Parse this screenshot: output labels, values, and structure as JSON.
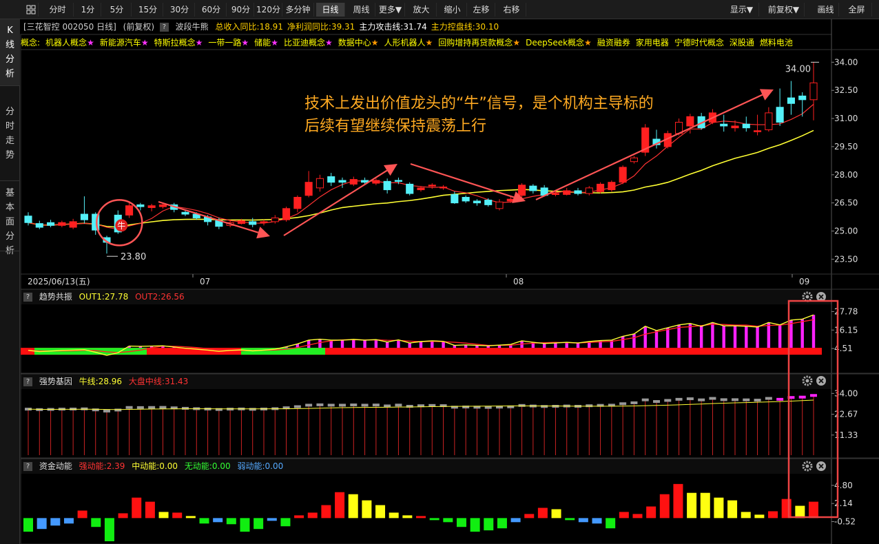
{
  "toolbar": {
    "items": [
      {
        "label": "分时"
      },
      {
        "label": "1分"
      },
      {
        "label": "5分"
      },
      {
        "label": "15分"
      },
      {
        "label": "30分"
      },
      {
        "label": "60分"
      },
      {
        "label": "90分"
      },
      {
        "label": "120分"
      },
      {
        "label": "多分钟"
      },
      {
        "label": "日线",
        "active": true
      },
      {
        "label": "周线"
      },
      {
        "label": "更多▼"
      },
      {
        "label": "放大"
      },
      {
        "label": "缩小"
      },
      {
        "label": "左移"
      },
      {
        "label": "右移"
      }
    ],
    "right": [
      {
        "label": "显示▼"
      },
      {
        "label": "前复权▼"
      },
      {
        "label": "画线"
      },
      {
        "label": "全屏"
      }
    ]
  },
  "sidebar": [
    {
      "label": "K线分析",
      "active": true
    },
    {
      "label": "分时走势"
    },
    {
      "label": "基本面分析"
    }
  ],
  "header": {
    "stock": "[三花智控 002050 日线]",
    "adjust": "(前复权)",
    "indicator": "波段牛熊",
    "fields": [
      {
        "text": "总收入同比:18.91",
        "color": "#ffd000"
      },
      {
        "text": "净利润同比:39.31",
        "color": "#ffd000"
      },
      {
        "text": "主力攻击线:31.74",
        "color": "#ffffff"
      },
      {
        "text": "主力控盘线:30.10",
        "color": "#ffd000"
      }
    ]
  },
  "concepts": {
    "prefix": "概念:",
    "items": [
      {
        "name": "机器人概念",
        "star": "★",
        "star_color": "magenta"
      },
      {
        "name": "新能源汽车",
        "star": "★",
        "star_color": "magenta"
      },
      {
        "name": "特斯拉概念",
        "star": "★",
        "star_color": "magenta"
      },
      {
        "name": "一带一路",
        "star": "★",
        "star_color": "magenta"
      },
      {
        "name": "储能",
        "star": "★",
        "star_color": "magenta"
      },
      {
        "name": "比亚迪概念",
        "star": "★",
        "star_color": "magenta"
      },
      {
        "name": "数据中心",
        "star": "★",
        "star_color": "orange"
      },
      {
        "name": "人形机器人",
        "star": "★",
        "star_color": "orange"
      },
      {
        "name": "回购增持再贷款概念",
        "star": "★",
        "star_color": "orange"
      },
      {
        "name": "DeepSeek概念",
        "star": "★",
        "star_color": "orange"
      },
      {
        "name": "融资融券",
        "star": "",
        "star_color": ""
      },
      {
        "name": "家用电器",
        "star": "",
        "star_color": ""
      },
      {
        "name": "宁德时代概念",
        "star": "",
        "star_color": ""
      },
      {
        "name": "深股通",
        "star": "",
        "star_color": ""
      },
      {
        "name": "燃料电池",
        "star": "",
        "star_color": ""
      }
    ]
  },
  "main_chart": {
    "y_ticks": [
      "34.00",
      "32.50",
      "31.00",
      "29.50",
      "28.00",
      "26.50",
      "25.00",
      "23.50"
    ],
    "y_range": [
      23.0,
      34.6
    ],
    "date_label": "2025/06/13(五)",
    "month_labels": [
      "07",
      "08",
      "09"
    ],
    "high_label": "34.00",
    "low_label": "23.80",
    "signal_label": "牛",
    "annotation_line1": "技术上发出价值龙头的“牛”信号，是个机构主导标的",
    "annotation_line2": "后续有望继续保持震荡上行",
    "colors": {
      "up": "#ff2020",
      "down": "#54f0f8",
      "ma_fast": "#ff3333",
      "ma_slow": "#ffff33",
      "arrow": "#ff5555"
    }
  },
  "candles": [
    [
      25.8,
      25.45,
      26.0,
      25.3
    ],
    [
      25.4,
      25.2,
      25.55,
      25.1
    ],
    [
      25.45,
      25.3,
      25.6,
      25.2
    ],
    [
      25.3,
      25.45,
      25.55,
      25.2
    ],
    [
      25.2,
      25.5,
      25.65,
      25.1
    ],
    [
      25.9,
      25.6,
      26.85,
      25.4
    ],
    [
      25.9,
      25.05,
      26.0,
      24.8
    ],
    [
      24.65,
      24.4,
      24.75,
      23.8
    ],
    [
      25.85,
      24.95,
      26.1,
      24.85
    ],
    [
      25.85,
      26.35,
      26.6,
      25.7
    ],
    [
      26.4,
      26.3,
      26.5,
      26.1
    ],
    [
      26.25,
      26.35,
      26.45,
      26.05
    ],
    [
      26.3,
      26.4,
      26.5,
      26.2
    ],
    [
      26.4,
      26.15,
      26.5,
      26.0
    ],
    [
      26.0,
      25.9,
      26.1,
      25.8
    ],
    [
      25.9,
      25.7,
      26.0,
      25.6
    ],
    [
      25.75,
      25.5,
      25.85,
      25.3
    ],
    [
      25.55,
      25.25,
      25.7,
      25.1
    ],
    [
      25.3,
      25.45,
      25.6,
      25.2
    ],
    [
      25.4,
      25.55,
      25.65,
      25.35
    ],
    [
      25.5,
      25.35,
      25.7,
      25.2
    ],
    [
      25.45,
      25.5,
      25.6,
      25.3
    ],
    [
      25.5,
      25.7,
      25.85,
      25.4
    ],
    [
      25.6,
      26.2,
      26.3,
      25.5
    ],
    [
      26.2,
      26.8,
      26.9,
      26.0
    ],
    [
      26.9,
      27.6,
      28.2,
      26.8
    ],
    [
      27.3,
      27.8,
      28.0,
      27.1
    ],
    [
      27.9,
      27.6,
      28.1,
      27.4
    ],
    [
      27.7,
      27.6,
      27.85,
      27.3
    ],
    [
      27.5,
      27.75,
      27.9,
      27.4
    ],
    [
      27.7,
      27.6,
      27.85,
      27.45
    ],
    [
      27.55,
      27.7,
      27.8,
      27.45
    ],
    [
      27.65,
      27.2,
      27.8,
      27.0
    ],
    [
      27.7,
      27.65,
      27.85,
      27.5
    ],
    [
      27.5,
      27.0,
      27.6,
      26.9
    ],
    [
      27.2,
      27.3,
      27.4,
      27.1
    ],
    [
      27.4,
      27.45,
      27.55,
      27.25
    ],
    [
      27.3,
      27.35,
      27.45,
      27.2
    ],
    [
      26.95,
      26.5,
      27.1,
      26.45
    ],
    [
      26.8,
      26.6,
      26.9,
      26.5
    ],
    [
      26.6,
      26.5,
      26.7,
      26.35
    ],
    [
      26.65,
      26.4,
      26.75,
      26.3
    ],
    [
      26.2,
      26.55,
      26.7,
      26.1
    ],
    [
      26.6,
      26.7,
      26.85,
      26.5
    ],
    [
      26.9,
      27.45,
      27.55,
      26.8
    ],
    [
      27.4,
      27.15,
      27.5,
      27.0
    ],
    [
      27.3,
      26.9,
      27.45,
      26.85
    ],
    [
      26.95,
      27.0,
      27.15,
      26.85
    ],
    [
      26.95,
      27.15,
      27.3,
      26.9
    ],
    [
      27.15,
      27.0,
      27.3,
      26.9
    ],
    [
      27.0,
      27.3,
      27.4,
      26.9
    ],
    [
      27.1,
      27.5,
      27.6,
      27.0
    ],
    [
      27.2,
      27.6,
      27.7,
      27.1
    ],
    [
      27.6,
      28.4,
      28.5,
      27.5
    ],
    [
      28.7,
      28.9,
      29.0,
      28.6
    ],
    [
      29.2,
      30.5,
      30.7,
      29.0
    ],
    [
      29.9,
      29.6,
      30.4,
      29.4
    ],
    [
      29.5,
      30.2,
      30.35,
      29.4
    ],
    [
      30.2,
      30.8,
      31.0,
      30.1
    ],
    [
      30.6,
      31.1,
      31.25,
      30.2
    ],
    [
      31.1,
      30.5,
      31.3,
      30.4
    ],
    [
      30.8,
      31.3,
      31.5,
      30.7
    ],
    [
      30.7,
      30.6,
      31.2,
      30.3
    ],
    [
      30.5,
      30.6,
      30.9,
      30.3
    ],
    [
      30.7,
      30.5,
      31.1,
      30.3
    ],
    [
      30.3,
      30.35,
      31.2,
      30.1
    ],
    [
      30.4,
      31.3,
      31.6,
      30.3
    ],
    [
      31.6,
      30.8,
      32.6,
      30.6
    ],
    [
      32.1,
      31.8,
      33.0,
      31.2
    ],
    [
      32.2,
      32.0,
      32.4,
      31.1
    ],
    [
      32.0,
      32.9,
      34.0,
      30.9
    ]
  ],
  "panel1": {
    "title": "趋势共振",
    "out1": "OUT1:27.78",
    "out2": "OUT2:26.56",
    "y_ticks": [
      "27.78",
      "16.15",
      "4.51"
    ],
    "y_range": [
      -8,
      31
    ]
  },
  "panel2": {
    "title": "强势基因",
    "bull": "牛线:28.96",
    "market": "大盘中线:31.43",
    "y_ticks": [
      "34.00",
      "22.67",
      "11.33"
    ],
    "y_range": [
      0,
      36
    ]
  },
  "panel3": {
    "title": "资金动能",
    "strong": "强动能:2.39",
    "mid": "中动能:0.00",
    "none": "无动能:0.00",
    "weak": "弱动能:0.00",
    "y_ticks": [
      "4.80",
      "2.14",
      "-0.52"
    ],
    "y_range": [
      -3.6,
      6.5
    ]
  },
  "momentum": [
    [
      -2.0,
      "g"
    ],
    [
      -1.6,
      "b"
    ],
    [
      -1.1,
      "b"
    ],
    [
      -0.8,
      "b"
    ],
    [
      1.1,
      "r"
    ],
    [
      -1.3,
      "g"
    ],
    [
      -3.4,
      "g"
    ],
    [
      0.7,
      "r"
    ],
    [
      3.0,
      "r"
    ],
    [
      2.4,
      "r"
    ],
    [
      0.9,
      "y"
    ],
    [
      0.8,
      "r"
    ],
    [
      0.3,
      "y"
    ],
    [
      -0.8,
      "g"
    ],
    [
      -0.6,
      "b"
    ],
    [
      -0.9,
      "g"
    ],
    [
      -2.0,
      "g"
    ],
    [
      -1.6,
      "g"
    ],
    [
      -0.4,
      "b"
    ],
    [
      -1.2,
      "g"
    ],
    [
      0.4,
      "r"
    ],
    [
      0.8,
      "r"
    ],
    [
      1.9,
      "r"
    ],
    [
      3.8,
      "r"
    ],
    [
      3.5,
      "y"
    ],
    [
      2.6,
      "y"
    ],
    [
      1.9,
      "y"
    ],
    [
      0.8,
      "y"
    ],
    [
      0.4,
      "y"
    ],
    [
      0.3,
      "r"
    ],
    [
      -0.3,
      "g"
    ],
    [
      -0.6,
      "g"
    ],
    [
      -1.3,
      "g"
    ],
    [
      -2.0,
      "g"
    ],
    [
      -1.8,
      "g"
    ],
    [
      -1.5,
      "g"
    ],
    [
      -0.6,
      "b"
    ],
    [
      0.6,
      "r"
    ],
    [
      1.5,
      "r"
    ],
    [
      1.3,
      "y"
    ],
    [
      -0.3,
      "g"
    ],
    [
      -0.6,
      "b"
    ],
    [
      -0.8,
      "b"
    ],
    [
      -1.5,
      "g"
    ],
    [
      0.9,
      "r"
    ],
    [
      0.6,
      "r"
    ],
    [
      1.7,
      "r"
    ],
    [
      3.5,
      "r"
    ],
    [
      5.0,
      "r"
    ],
    [
      3.7,
      "y"
    ],
    [
      3.7,
      "y"
    ],
    [
      3.0,
      "y"
    ],
    [
      2.6,
      "y"
    ],
    [
      0.9,
      "y"
    ],
    [
      0.5,
      "y"
    ],
    [
      1.0,
      "r"
    ],
    [
      2.8,
      "r"
    ],
    [
      1.8,
      "y"
    ],
    [
      2.4,
      "r"
    ]
  ]
}
